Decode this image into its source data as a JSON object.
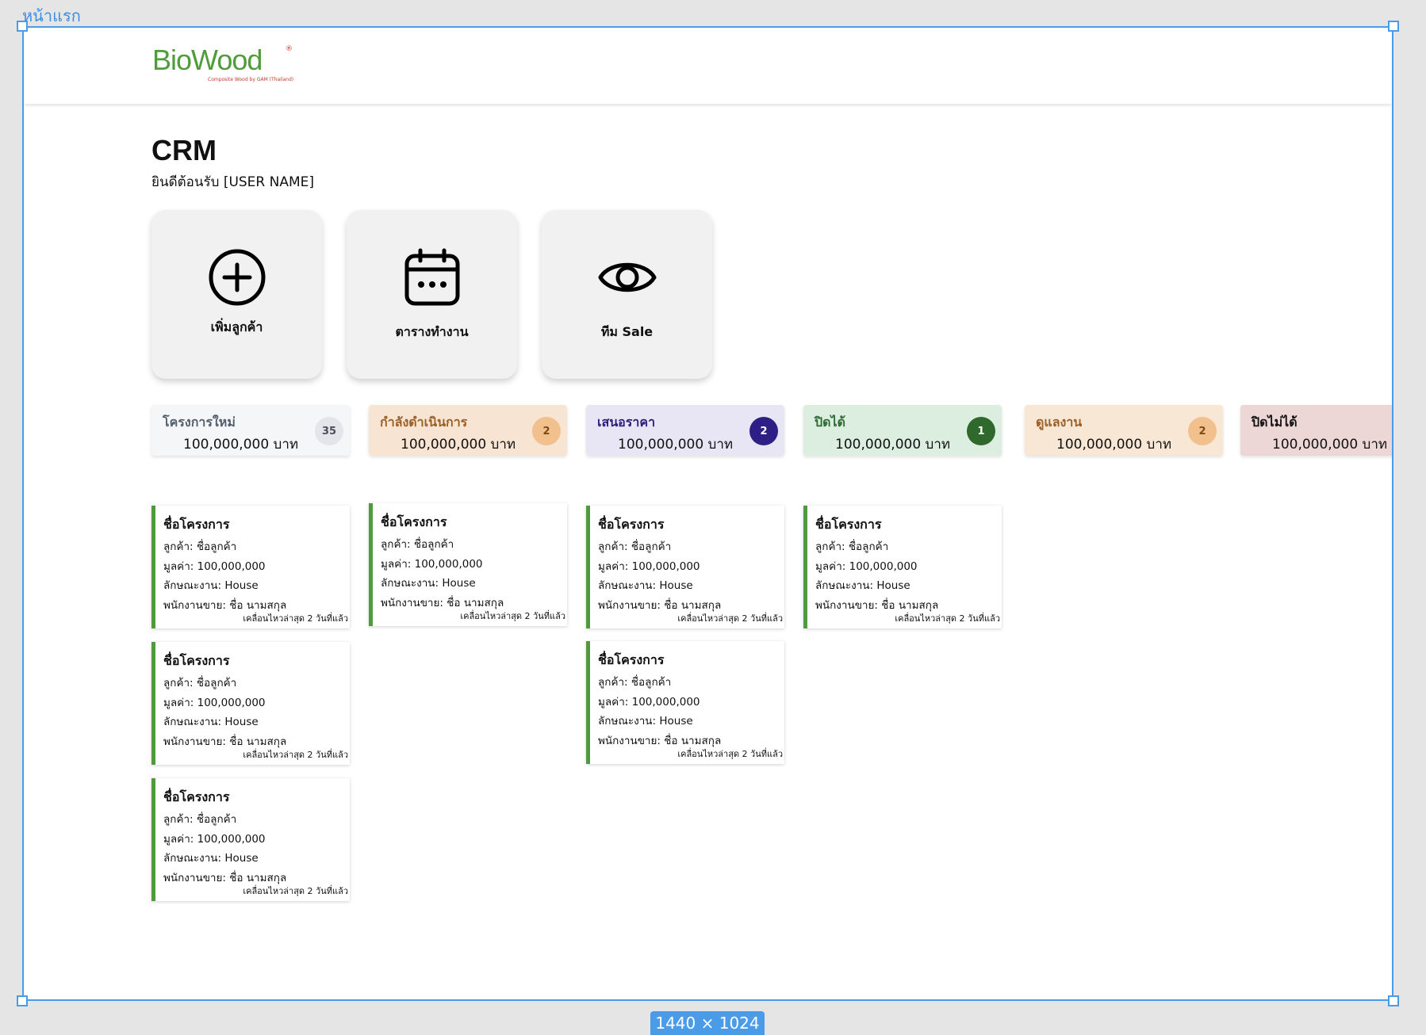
{
  "frame": {
    "name": "หน้าแรก",
    "size_label": "1440 × 1024"
  },
  "logo": {
    "text": "BioWood",
    "tagline": "Composite Wood by GAM (Thailand)",
    "reg": "®"
  },
  "page": {
    "title": "CRM",
    "welcome": "ยินดีต้อนรับ [USER NAME]"
  },
  "actions": [
    {
      "label": "เพิ่มลูกค้า",
      "icon": "plus-circle-icon"
    },
    {
      "label": "ตารางทำงาน",
      "icon": "calendar-icon"
    },
    {
      "label": "ทีม Sale",
      "icon": "eye-icon"
    }
  ],
  "stages": [
    {
      "name": "โครงการใหม่",
      "amount": "100,000,000 บาท",
      "count": "35",
      "bg": "#f5f6f7",
      "name_color": "#555e6e",
      "badge_bg": "#e2e5ea",
      "badge_color": "#4a4f58"
    },
    {
      "name": "กำลังดำเนินการ",
      "amount": "100,000,000 บาท",
      "count": "2",
      "bg": "#f8e4d2",
      "name_color": "#9a5f25",
      "badge_bg": "#f2c08d",
      "badge_color": "#7a4a16"
    },
    {
      "name": "เสนอราคา",
      "amount": "100,000,000 บาท",
      "count": "2",
      "bg": "#e8e5f5",
      "name_color": "#2d1f7a",
      "badge_bg": "#2e1f86",
      "badge_color": "#ffffff"
    },
    {
      "name": "ปิดได้",
      "amount": "100,000,000 บาท",
      "count": "1",
      "bg": "#dbeee0",
      "name_color": "#2e6a32",
      "badge_bg": "#2f6a2c",
      "badge_color": "#ffffff"
    },
    {
      "name": "ดูแลงาน",
      "amount": "100,000,000 บาท",
      "count": "2",
      "bg": "#f9e7d6",
      "name_color": "#9a5f25",
      "badge_bg": "#f2c08d",
      "badge_color": "#7a4a16"
    },
    {
      "name": "ปิดไม่ได้",
      "amount": "100,000,000 บาท",
      "count": "",
      "bg": "#ecd6d6",
      "name_color": "#111111",
      "badge_bg": "#c0392b",
      "badge_color": "#ffffff"
    }
  ],
  "card_template": {
    "title": "ชื่อโครงการ",
    "customer": "ลูกค้า: ชื่อลูกค้า",
    "value": "มูลค่า: 100,000,000",
    "job_type": "ลักษณะงาน: House",
    "salesperson": "พนักงานขาย: ชื่อ นามสกุล",
    "last_moved": "เคลื่อนไหวล่าสุด 2 วันที่แล้ว"
  },
  "columns": [
    {
      "cards": 3
    },
    {
      "cards": 1
    },
    {
      "cards": 2
    },
    {
      "cards": 1
    },
    {
      "cards": 0
    },
    {
      "cards": 0
    }
  ]
}
